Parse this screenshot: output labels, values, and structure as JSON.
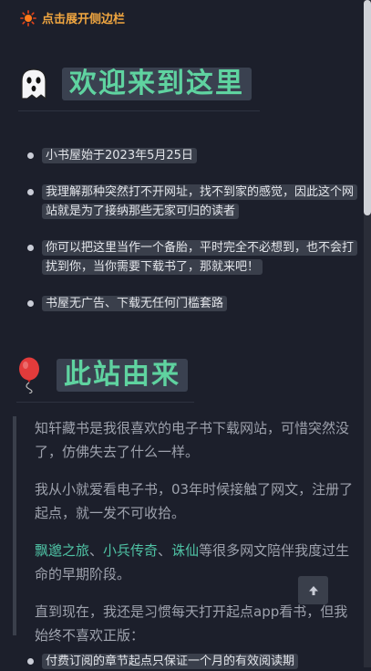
{
  "header": {
    "toggle_label": "点击展开侧边栏"
  },
  "section1": {
    "title": "欢迎来到这里",
    "items": [
      "小书屋始于2023年5月25日",
      "我理解那种突然打不开网址，找不到家的感觉，因此这个网站就是为了接纳那些无家可归的读者",
      "你可以把这里当作一个备胎，平时完全不必想到，也不会打扰到你，当你需要下载书了，那就来吧！",
      "书屋无广告、下载无任何门槛套路"
    ]
  },
  "section2": {
    "title": "此站由来",
    "p1": "知轩藏书是我很喜欢的电子书下载网站，可惜突然没了，仿佛失去了什么一样。",
    "p2": "我从小就爱看电子书，03年时候接触了网文，注册了起点，就一发不可收拾。",
    "p3": {
      "link1": "飘邈之旅",
      "sep1": "、",
      "link2": "小兵传奇",
      "sep2": "、",
      "link3": "诛仙",
      "rest": "等很多网文陪伴我度过生命的早期阶段。"
    },
    "p4": "直到现在，我还是习惯每天打开起点app看书，但我始终不喜欢正版：",
    "bottom_item": "付费订阅的章节起点只保证一个月的有效阅读期"
  },
  "icons": {
    "sun": "sun-icon",
    "ghost": "ghost-icon",
    "balloon": "balloon-icon",
    "up": "arrow-up-icon"
  }
}
